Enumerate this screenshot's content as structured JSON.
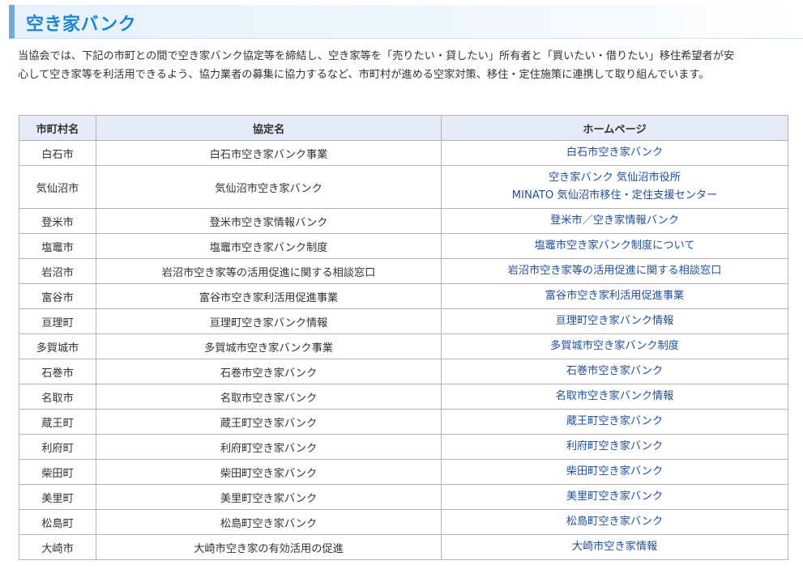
{
  "title": "空き家バンク",
  "intro": {
    "line1": "当協会では、下記の市町との間で空き家バンク協定等を締結し、空き家等を「売りたい・貸したい」所有者と「買いたい・借りたい」移住希望者が安",
    "line2": "心して空き家等を利活用できるよう、協力業者の募集に協力するなど、市町村が進める空家対策、移住・定住施策に連携して取り組んでいます。"
  },
  "table": {
    "headers": [
      "市町村名",
      "協定名",
      "ホームページ"
    ],
    "rows": [
      {
        "city": "白石市",
        "agreement": "白石市空き家バンク事業",
        "links": [
          "白石市空き家バンク"
        ]
      },
      {
        "city": "気仙沼市",
        "agreement": "気仙沼市空き家バンク",
        "links": [
          "空き家バンク 気仙沼市役所",
          "MINATO 気仙沼市移住・定住支援センター"
        ]
      },
      {
        "city": "登米市",
        "agreement": "登米市空き家情報バンク",
        "links": [
          "登米市／空き家情報バンク"
        ]
      },
      {
        "city": "塩竈市",
        "agreement": "塩竈市空き家バンク制度",
        "links": [
          "塩竈市空き家バンク制度について"
        ]
      },
      {
        "city": "岩沼市",
        "agreement": "岩沼市空き家等の活用促進に関する相談窓口",
        "links": [
          "岩沼市空き家等の活用促進に関する相談窓口"
        ]
      },
      {
        "city": "富谷市",
        "agreement": "富谷市空き家利活用促進事業",
        "links": [
          "富谷市空き家利活用促進事業"
        ]
      },
      {
        "city": "亘理町",
        "agreement": "亘理町空き家バンク情報",
        "links": [
          "亘理町空き家バンク情報"
        ]
      },
      {
        "city": "多賀城市",
        "agreement": "多賀城市空き家バンク事業",
        "links": [
          "多賀城市空き家バンク制度"
        ]
      },
      {
        "city": "石巻市",
        "agreement": "石巻市空き家バンク",
        "links": [
          "石巻市空き家バンク"
        ]
      },
      {
        "city": "名取市",
        "agreement": "名取市空き家バンク",
        "links": [
          "名取市空き家バンク情報"
        ]
      },
      {
        "city": "蔵王町",
        "agreement": "蔵王町空き家バンク",
        "links": [
          "蔵王町空き家バンク"
        ]
      },
      {
        "city": "利府町",
        "agreement": "利府町空き家バンク",
        "links": [
          "利府町空き家バンク"
        ]
      },
      {
        "city": "柴田町",
        "agreement": "柴田町空き家バンク",
        "links": [
          "柴田町空き家バンク"
        ]
      },
      {
        "city": "美里町",
        "agreement": "美里町空き家バンク",
        "links": [
          "美里町空き家バンク"
        ]
      },
      {
        "city": "松島町",
        "agreement": "松島町空き家バンク",
        "links": [
          "松島町空き家バンク"
        ]
      },
      {
        "city": "大崎市",
        "agreement": "大崎市空き家の有効活用の促進",
        "links": [
          "大崎市空き家情報"
        ]
      }
    ]
  },
  "colors": {
    "title": "#1e86d6",
    "title_accent": "#6fa8dc",
    "header_bg": "#e5ecf8",
    "link": "#1f4f9c",
    "border": "#b3b3b3"
  }
}
